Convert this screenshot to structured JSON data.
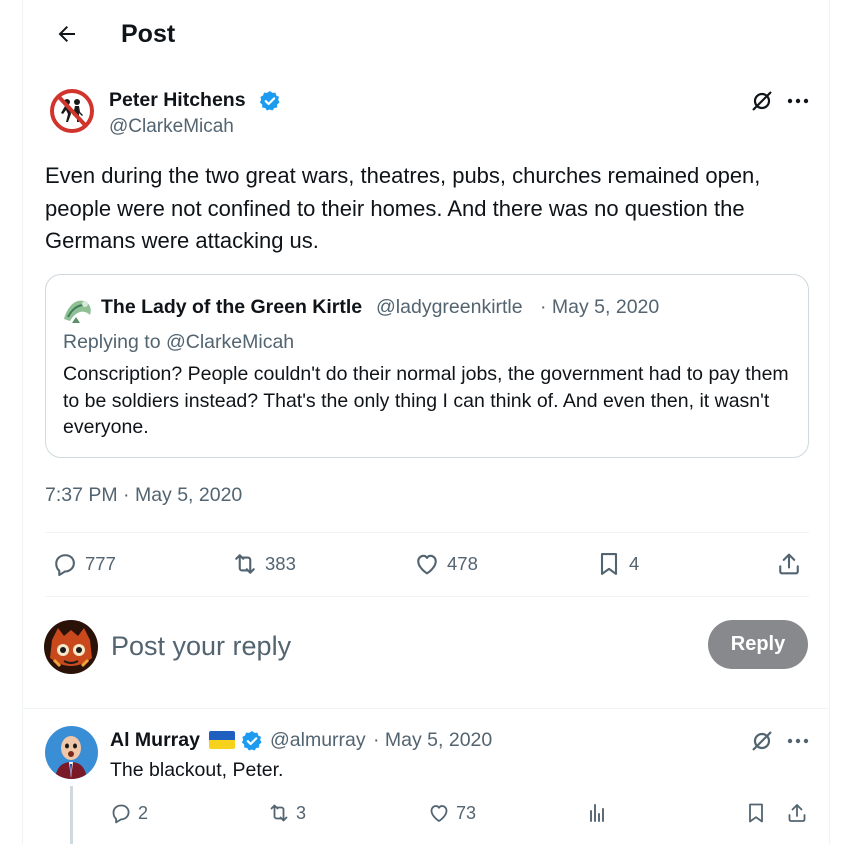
{
  "header": {
    "back_icon": "arrow-left-icon",
    "title": "Post"
  },
  "post": {
    "author_name": "Peter Hitchens",
    "author_handle": "@ClarkeMicah",
    "text": "Even during the two great wars, theatres, pubs, churches remained open, people were not confined to their homes. And there was no question the Germans were attacking us.",
    "timestamp": "7:37 PM · May 5, 2020",
    "stats": {
      "replies": "777",
      "reposts": "383",
      "likes": "478",
      "bookmarks": "4"
    }
  },
  "quote": {
    "author_name": "The Lady of the Green Kirtle",
    "author_handle": "@ladygreenkirtle",
    "date": "· May 5, 2020",
    "replying_to": "Replying to @ClarkeMicah",
    "text": "Conscription? People couldn't do their normal jobs, the government had to pay them to be soldiers instead? That's the only thing I can think of. And even then, it wasn't everyone."
  },
  "composer": {
    "placeholder": "Post your reply",
    "button_label": "Reply"
  },
  "reply": {
    "author_name": "Al Murray",
    "flag": "🇺🇦",
    "author_handle": "@almurray",
    "date": "· May 5, 2020",
    "text": "The blackout, Peter.",
    "stats": {
      "replies": "2",
      "reposts": "3",
      "likes": "73"
    }
  },
  "colors": {
    "verified": "#1d9bf0",
    "secondary_text": "#536471",
    "border": "#cfd9de",
    "reply_button": "#87898c"
  }
}
